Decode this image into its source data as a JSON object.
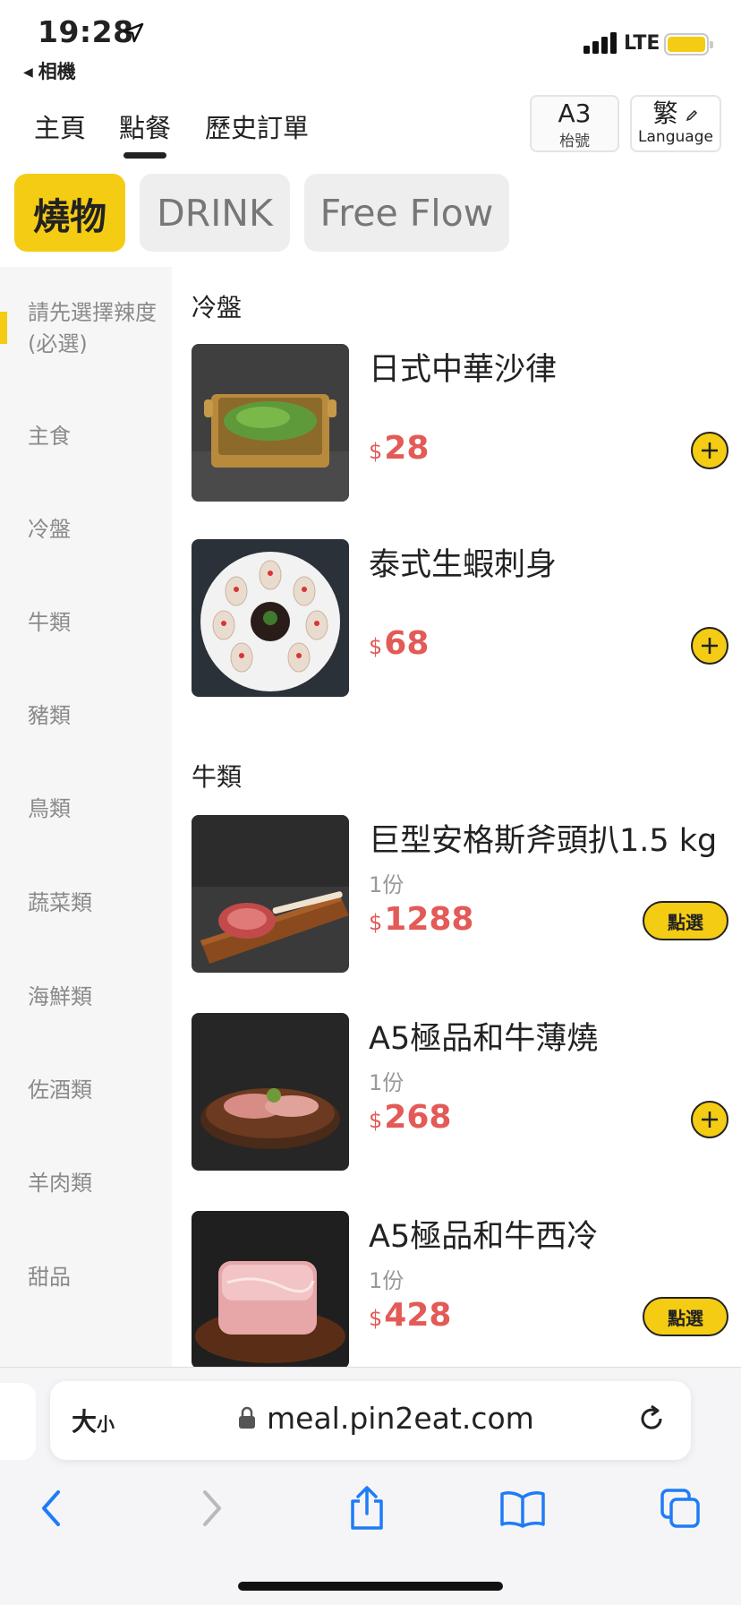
{
  "status": {
    "time": "19:28",
    "back_app": "相機",
    "network": "LTE"
  },
  "nav": {
    "tabs": [
      {
        "label": "主頁"
      },
      {
        "label": "點餐"
      },
      {
        "label": "歷史訂單"
      }
    ],
    "active_tab": "點餐",
    "table": {
      "code": "A3",
      "label": "枱號"
    },
    "language": {
      "code": "繁",
      "label": "Language"
    }
  },
  "categories": [
    {
      "label": "燒物",
      "active": true
    },
    {
      "label": "DRINK",
      "active": false
    },
    {
      "label": "Free Flow",
      "active": false
    }
  ],
  "sidebar": {
    "items": [
      {
        "label": "請先選擇辣度(必選)"
      },
      {
        "label": "主食"
      },
      {
        "label": "冷盤"
      },
      {
        "label": "牛類"
      },
      {
        "label": "豬類"
      },
      {
        "label": "鳥類"
      },
      {
        "label": "蔬菜類"
      },
      {
        "label": "海鮮類"
      },
      {
        "label": "佐酒類"
      },
      {
        "label": "羊肉類"
      },
      {
        "label": "甜品"
      }
    ]
  },
  "menu": {
    "sections": [
      {
        "title": "冷盤",
        "items": [
          {
            "name": "日式中華沙律",
            "qty": "",
            "currency": "$",
            "price": "28",
            "action": "add"
          },
          {
            "name": "泰式生蝦刺身",
            "qty": "",
            "currency": "$",
            "price": "68",
            "action": "add"
          }
        ]
      },
      {
        "title": "牛類",
        "items": [
          {
            "name": "巨型安格斯斧頭扒1.5 kg",
            "qty": "1份",
            "currency": "$",
            "price": "1288",
            "action": "select",
            "action_label": "點選"
          },
          {
            "name": "A5極品和牛薄燒",
            "qty": "1份",
            "currency": "$",
            "price": "268",
            "action": "add"
          },
          {
            "name": "A5極品和牛西冷",
            "qty": "1份",
            "currency": "$",
            "price": "428",
            "action": "select",
            "action_label": "點選"
          }
        ]
      }
    ]
  },
  "browser": {
    "text_size": "大",
    "text_size_small": "小",
    "url": "meal.pin2eat.com"
  },
  "colors": {
    "accent": "#f4cc14",
    "price": "#e35a57"
  }
}
